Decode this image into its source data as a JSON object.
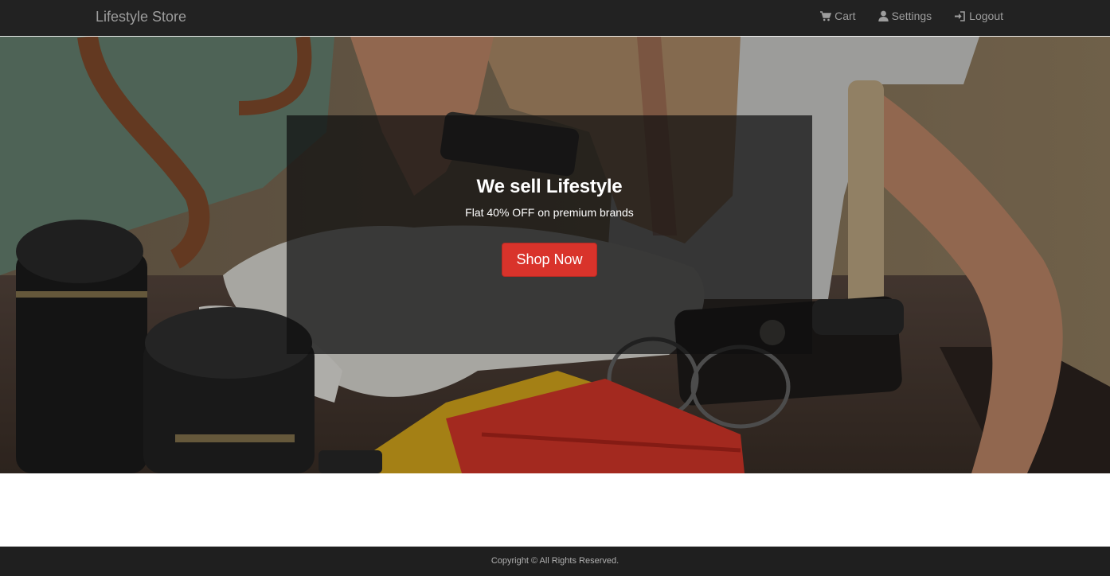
{
  "navbar": {
    "brand": "Lifestyle Store",
    "links": [
      {
        "label": "Cart",
        "icon": "cart-icon"
      },
      {
        "label": "Settings",
        "icon": "user-icon"
      },
      {
        "label": "Logout",
        "icon": "login-icon"
      }
    ]
  },
  "banner": {
    "headline": "We sell Lifestyle",
    "tagline": "Flat 40% OFF on premium brands",
    "cta_label": "Shop Now"
  },
  "footer": {
    "copyright": "Copyright © All Rights Reserved."
  },
  "colors": {
    "navbar_bg": "#222222",
    "nav_text": "#9d9d9d",
    "cta_bg": "#d9332b",
    "footer_bg": "#1f1f1f"
  }
}
